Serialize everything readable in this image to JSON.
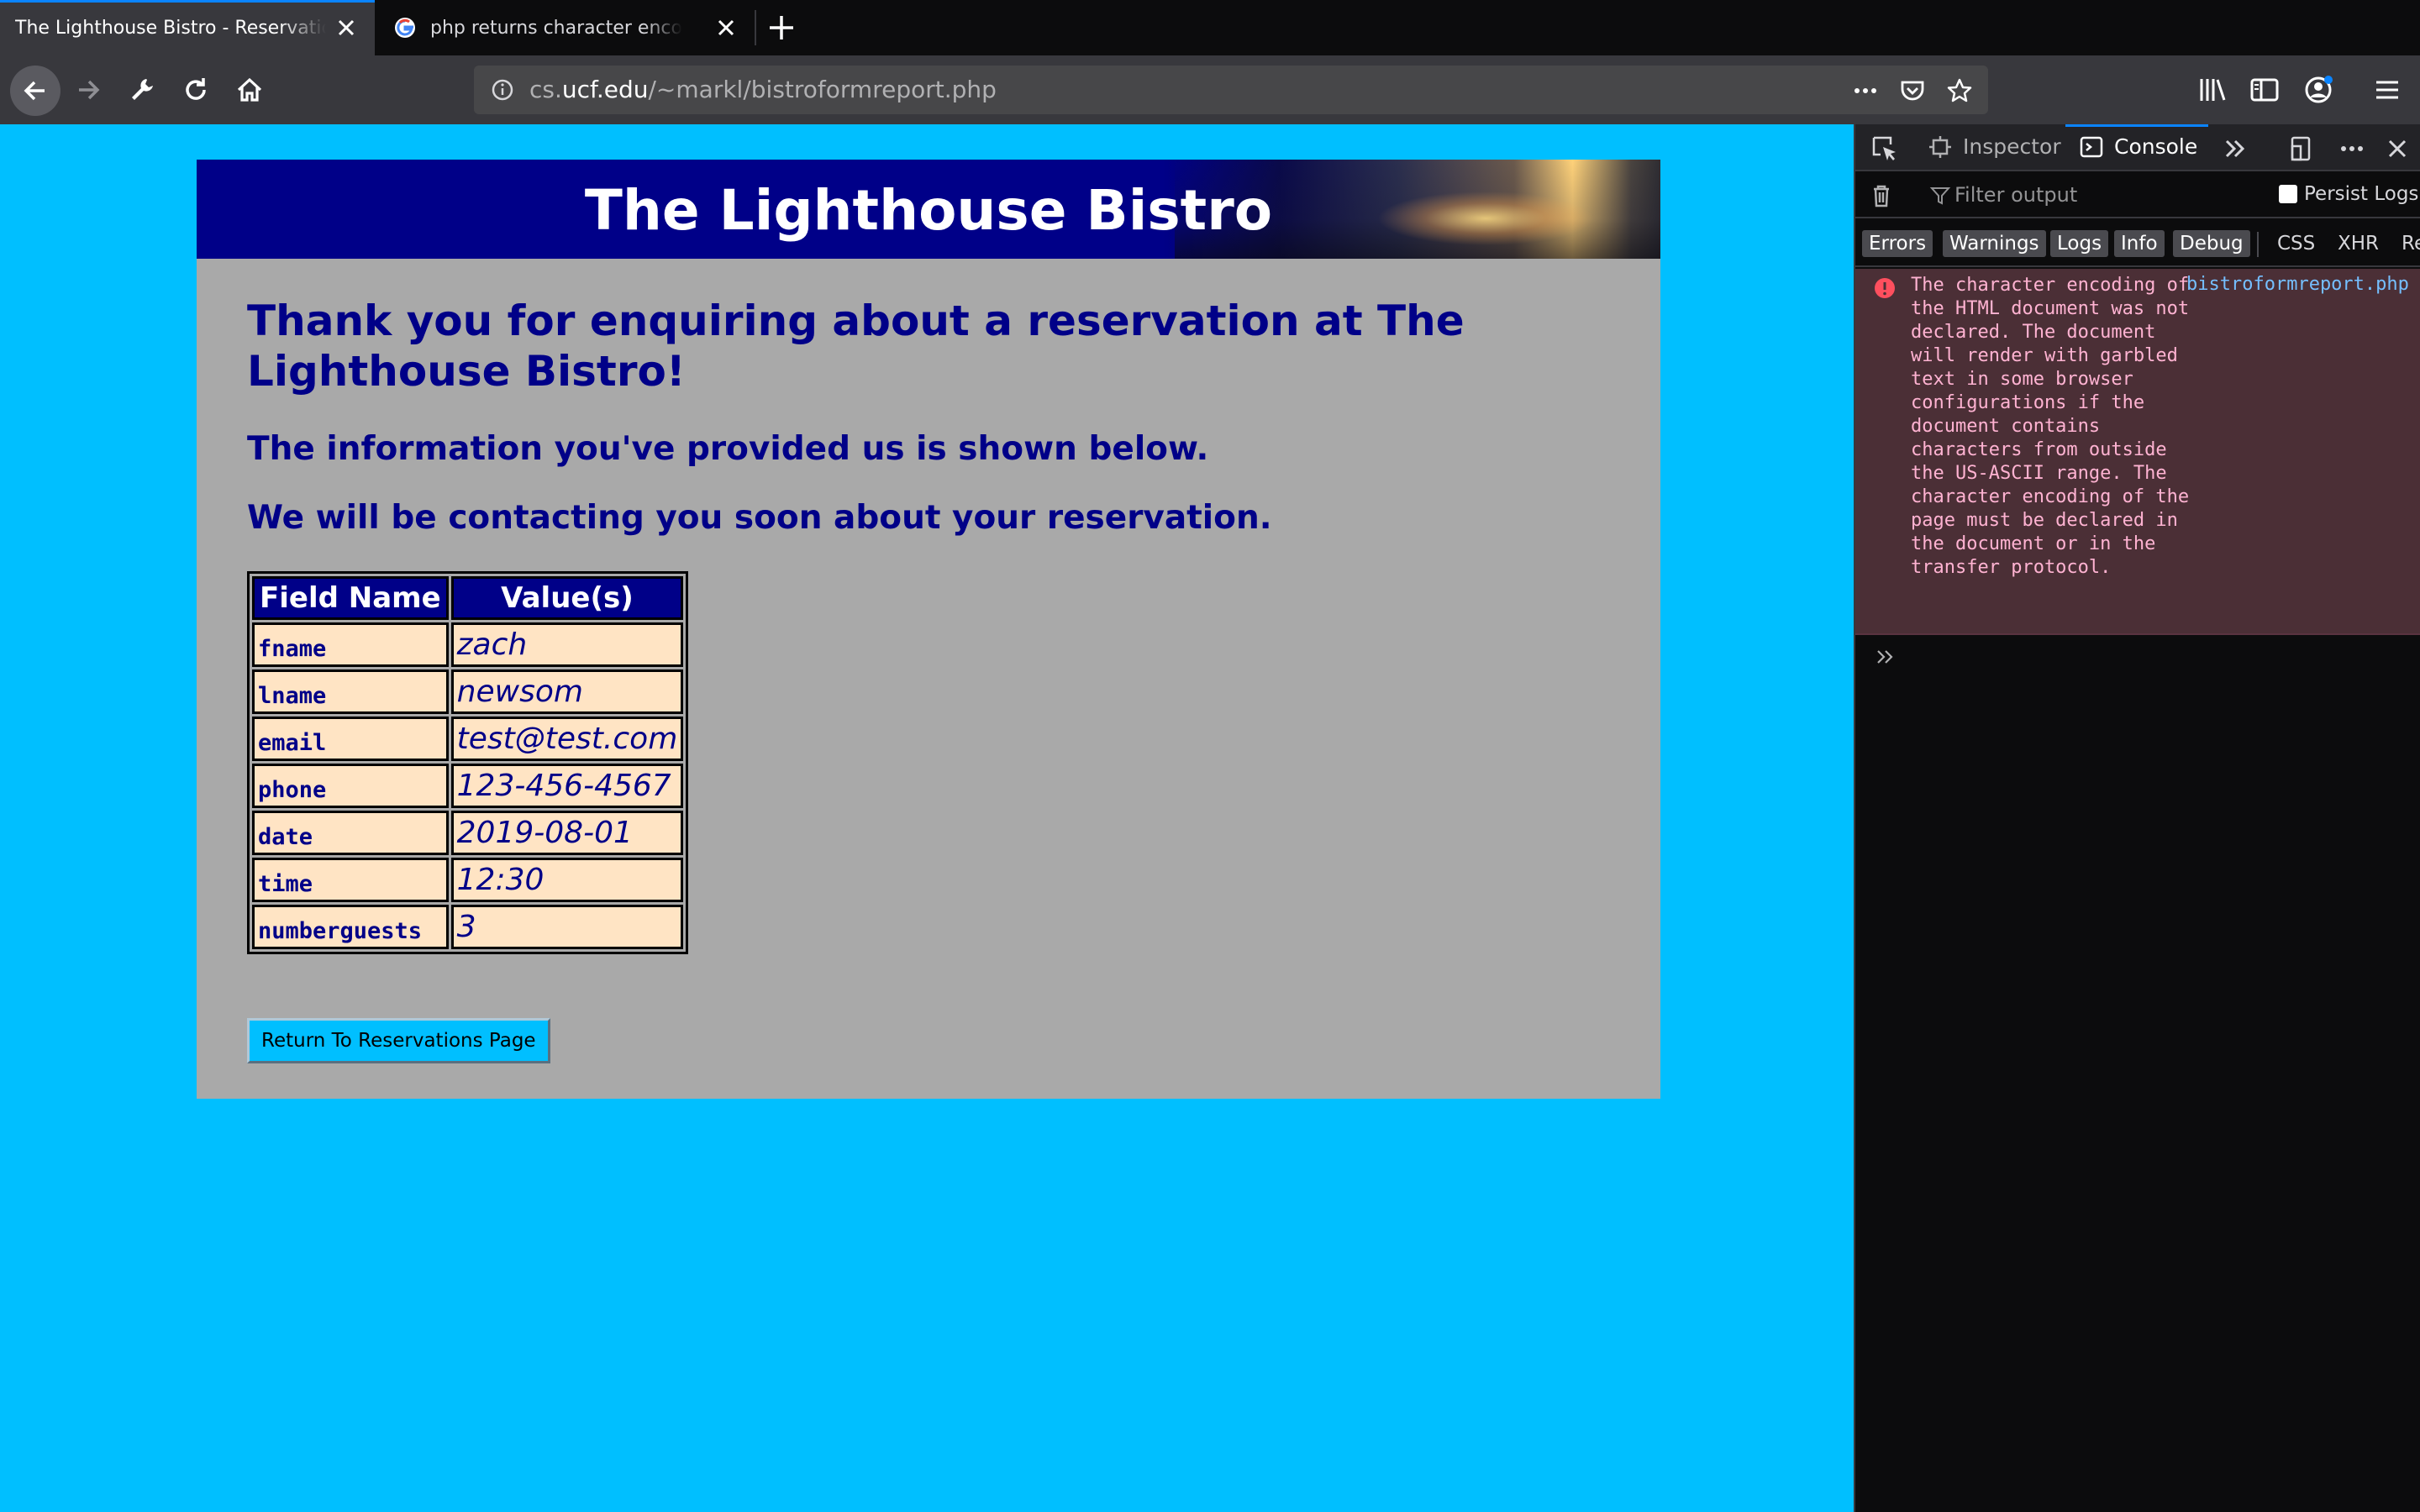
{
  "browser": {
    "tabs": [
      {
        "title": "The Lighthouse Bistro - Reservation",
        "active": true
      },
      {
        "title": "php returns character encoding",
        "active": false
      }
    ],
    "url": {
      "prefix": "cs.",
      "host": "ucf.edu",
      "path": "/~markl/bistroformreport.php"
    }
  },
  "page": {
    "banner_title": "The Lighthouse Bistro",
    "heading_thanks": "Thank you for enquiring about a reservation at The Lighthouse Bistro!",
    "heading_info": "The information you've provided us is shown below.",
    "heading_contact": "We will be contacting you soon about your reservation.",
    "table": {
      "headers": [
        "Field Name",
        "Value(s)"
      ],
      "rows": [
        {
          "field": "fname",
          "value": "zach"
        },
        {
          "field": "lname",
          "value": "newsom"
        },
        {
          "field": "email",
          "value": "test@test.com"
        },
        {
          "field": "phone",
          "value": "123-456-4567"
        },
        {
          "field": "date",
          "value": "2019-08-01"
        },
        {
          "field": "time",
          "value": "12:30"
        },
        {
          "field": "numberguests",
          "value": "3"
        }
      ]
    },
    "return_button": "Return To Reservations Page",
    "colors": {
      "viewport_bg": "#00bfff",
      "card_bg": "#a9a9a9",
      "navy": "#000088",
      "cell_bg": "#ffe4c4"
    }
  },
  "devtools": {
    "tabs": {
      "inspector": "Inspector",
      "console": "Console"
    },
    "filter_placeholder": "Filter output",
    "persist_logs": "Persist Logs",
    "categories": [
      "Errors",
      "Warnings",
      "Logs",
      "Info",
      "Debug",
      "CSS",
      "XHR",
      "Re"
    ],
    "message": {
      "text": "The character encoding of the HTML document was not declared. The document will render with garbled text in some browser configurations if the document contains characters from outside the US-ASCII range. The character encoding of the page must be declared in the document or in the transfer protocol.",
      "source": "bistroformreport.php"
    }
  }
}
